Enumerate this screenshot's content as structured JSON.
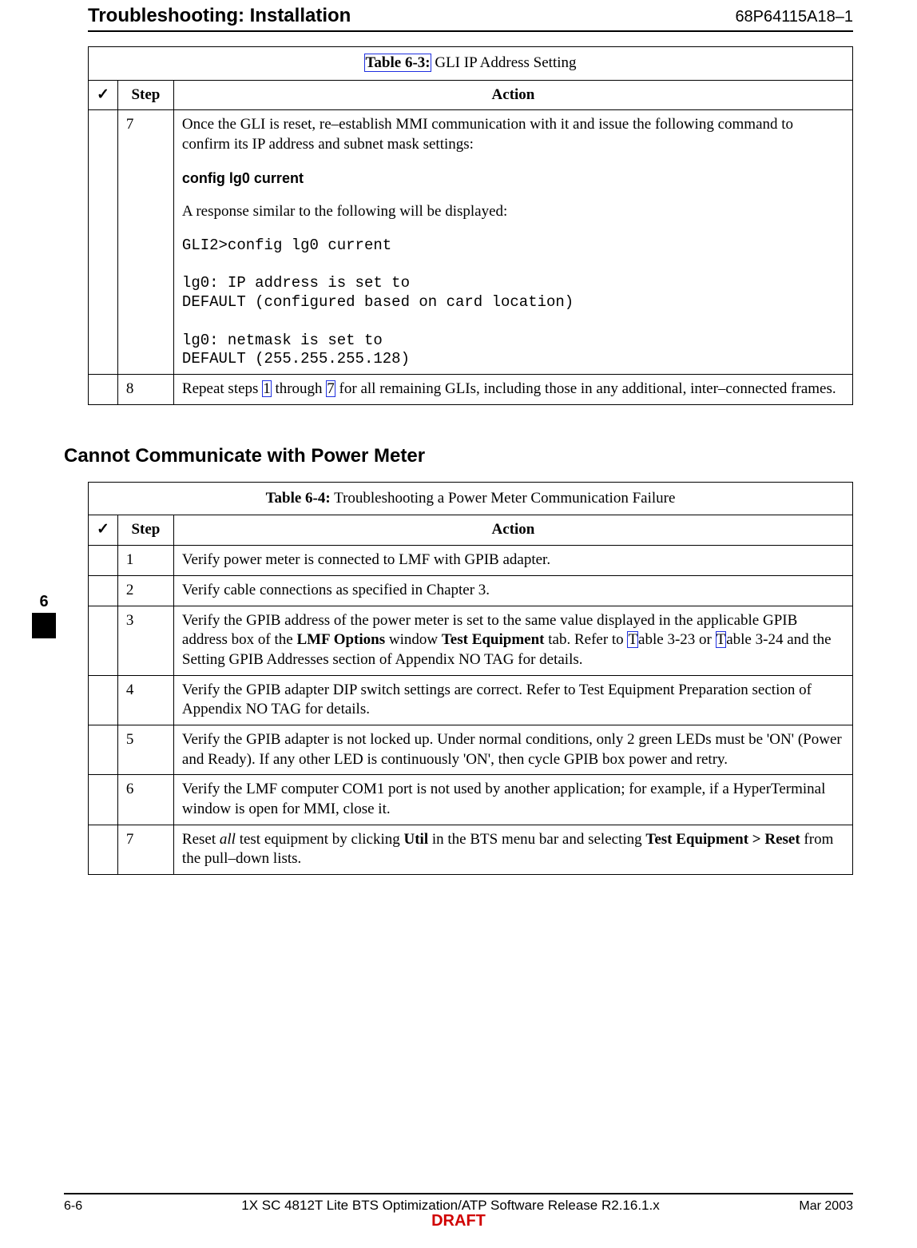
{
  "header": {
    "left": "Troubleshooting: Installation",
    "right": "68P64115A18–1"
  },
  "table63": {
    "title_label": "Table 6-3:",
    "title_text": " GLI IP Address Setting",
    "headers": {
      "check": "✓",
      "step": "Step",
      "action": "Action"
    },
    "rows": [
      {
        "step": "7",
        "intro": "Once the GLI is reset, re–establish MMI communication with it and issue the following command to confirm its IP address and subnet mask settings:",
        "cmd": "config lg0 current",
        "resp_intro": "A response similar to the following will be displayed:",
        "mono": "GLI2>config lg0 current\n\nlg0: IP address is set to\nDEFAULT (configured based on card location)\n\nlg0: netmask is set to\nDEFAULT (255.255.255.128)"
      },
      {
        "step": "8",
        "text_a": "Repeat steps ",
        "link1": "1",
        "text_b": " through ",
        "link2": "7",
        "text_c": " for all remaining GLIs, including those in any additional, inter–connected frames."
      }
    ]
  },
  "section_heading": "Cannot Communicate with Power Meter",
  "table64": {
    "title_label": "Table 6-4:",
    "title_text": " Troubleshooting a Power Meter Communication Failure",
    "headers": {
      "check": "✓",
      "step": "Step",
      "action": "Action"
    },
    "rows": [
      {
        "step": "1",
        "action": "Verify power meter is connected to LMF with GPIB adapter."
      },
      {
        "step": "2",
        "action": "Verify cable connections as specified in Chapter 3."
      },
      {
        "step": "3",
        "seg_a": "Verify the GPIB address of the power meter is set to the same value displayed in the applicable GPIB address box of the ",
        "b1": "LMF Options",
        "seg_b": " window ",
        "b2": "Test Equipment",
        "seg_c": " tab. Refer to ",
        "link1": "T",
        "seg_d": "able 3-23 or ",
        "link2": "T",
        "seg_e": "able 3-24 and the Setting GPIB Addresses section of Appendix NO TAG for details."
      },
      {
        "step": "4",
        "action": "Verify the GPIB adapter DIP switch settings are correct. Refer to Test Equipment Preparation section of Appendix NO TAG for details."
      },
      {
        "step": "5",
        "action": "Verify the GPIB adapter is not locked up. Under normal conditions, only 2 green LEDs must be 'ON' (Power and Ready). If any other LED is continuously 'ON', then cycle GPIB box power and retry."
      },
      {
        "step": "6",
        "action": "Verify the LMF computer COM1 port is not used by another application; for example, if a HyperTerminal window is open for MMI, close it."
      },
      {
        "step": "7",
        "seg_a": "Reset ",
        "it1": "all",
        "seg_b": " test equipment by clicking ",
        "b1": "Util",
        "seg_c": " in the BTS menu bar and selecting ",
        "b2": "Test Equipment > Reset",
        "seg_d": " from the pull–down lists."
      }
    ]
  },
  "side_tab": "6",
  "footer": {
    "left": "6-6",
    "center": "1X SC 4812T Lite BTS Optimization/ATP Software Release R2.16.1.x",
    "right": "Mar 2003",
    "draft": "DRAFT"
  }
}
